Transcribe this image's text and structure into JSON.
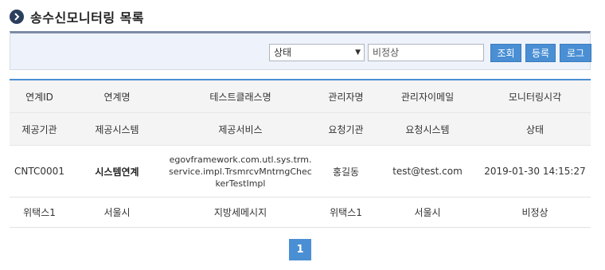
{
  "page": {
    "title": "송수신모니터링 목록"
  },
  "search": {
    "status_value": "상태",
    "input_value": "비정상",
    "search_label": "조회",
    "register_label": "등록",
    "log_label": "로그"
  },
  "table": {
    "header1": [
      "연계ID",
      "연계명",
      "테스트클래스명",
      "관리자명",
      "관리자이메일",
      "모니터링시각"
    ],
    "header2": [
      "제공기관",
      "제공시스템",
      "제공서비스",
      "요청기관",
      "요청시스템",
      "상태"
    ],
    "row1": [
      "CNTC0001",
      "시스템연계",
      "egovframework.com.utl.sys.trm.service.impl.TrsmrcvMntrngCheckerTestImpl",
      "홍길동",
      "test@test.com",
      "2019-01-30 14:15:27"
    ],
    "row2": [
      "위택스1",
      "서울시",
      "지방세메시지",
      "위택스1",
      "서울시",
      "비정상"
    ]
  },
  "pagination": {
    "current": "1"
  }
}
